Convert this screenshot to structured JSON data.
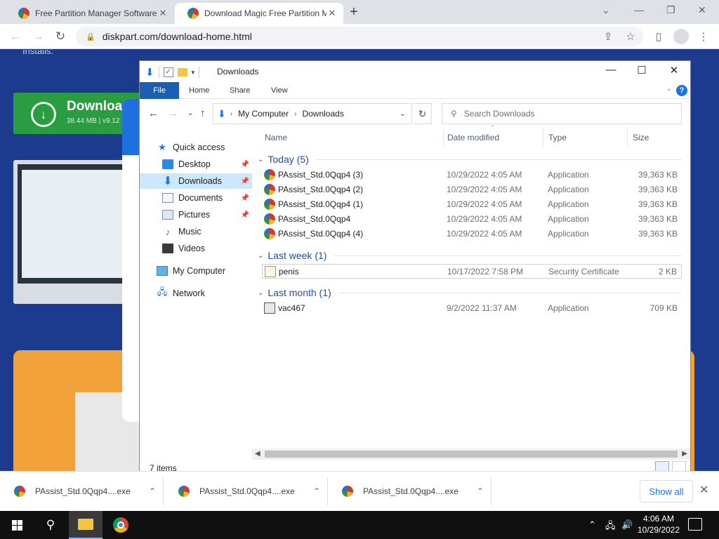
{
  "browser": {
    "tabs": [
      {
        "title": "Free Partition Manager Software"
      },
      {
        "title": "Download Magic Free Partition M"
      }
    ],
    "url": "diskpart.com/download-home.html"
  },
  "site": {
    "installs_text": "Installs:",
    "download_label": "Downloa",
    "download_meta": "38.44 MB | v9.12"
  },
  "explorer": {
    "window_title": "Downloads",
    "ribbon_tabs": [
      "File",
      "Home",
      "Share",
      "View"
    ],
    "address": {
      "root": "My Computer",
      "current": "Downloads"
    },
    "search_placeholder": "Search Downloads",
    "nav": [
      {
        "label": "Quick access",
        "icon": "star-icon"
      },
      {
        "label": "Desktop",
        "icon": "desktop-icon",
        "pinned": true
      },
      {
        "label": "Downloads",
        "icon": "download-icon",
        "pinned": true,
        "selected": true
      },
      {
        "label": "Documents",
        "icon": "documents-icon",
        "pinned": true
      },
      {
        "label": "Pictures",
        "icon": "pictures-icon",
        "pinned": true
      },
      {
        "label": "Music",
        "icon": "music-icon"
      },
      {
        "label": "Videos",
        "icon": "videos-icon"
      },
      {
        "label": "My Computer",
        "icon": "computer-icon"
      },
      {
        "label": "Network",
        "icon": "network-icon"
      }
    ],
    "columns": [
      "Name",
      "Date modified",
      "Type",
      "Size"
    ],
    "groups": [
      {
        "label": "Today (5)",
        "rows": [
          {
            "name": "PAssist_Std.0Qqp4 (3)",
            "date": "10/29/2022 4:05 AM",
            "type": "Application",
            "size": "39,363 KB",
            "icon": "app"
          },
          {
            "name": "PAssist_Std.0Qqp4 (2)",
            "date": "10/29/2022 4:05 AM",
            "type": "Application",
            "size": "39,363 KB",
            "icon": "app"
          },
          {
            "name": "PAssist_Std.0Qqp4 (1)",
            "date": "10/29/2022 4:05 AM",
            "type": "Application",
            "size": "39,363 KB",
            "icon": "app"
          },
          {
            "name": "PAssist_Std.0Qqp4",
            "date": "10/29/2022 4:05 AM",
            "type": "Application",
            "size": "39,363 KB",
            "icon": "app"
          },
          {
            "name": "PAssist_Std.0Qqp4 (4)",
            "date": "10/29/2022 4:05 AM",
            "type": "Application",
            "size": "39,363 KB",
            "icon": "app"
          }
        ]
      },
      {
        "label": "Last week (1)",
        "rows": [
          {
            "name": "penis",
            "date": "10/17/2022 7:58 PM",
            "type": "Security Certificate",
            "size": "2 KB",
            "icon": "cert"
          }
        ]
      },
      {
        "label": "Last month (1)",
        "rows": [
          {
            "name": "vac467",
            "date": "9/2/2022 11:37 AM",
            "type": "Application",
            "size": "709 KB",
            "icon": "exe"
          }
        ]
      }
    ],
    "status": "7 items"
  },
  "downloads_shelf": {
    "items": [
      "PAssist_Std.0Qqp4....exe",
      "PAssist_Std.0Qqp4....exe",
      "PAssist_Std.0Qqp4....exe"
    ],
    "show_all": "Show all"
  },
  "taskbar": {
    "time": "4:06 AM",
    "date": "10/29/2022"
  }
}
